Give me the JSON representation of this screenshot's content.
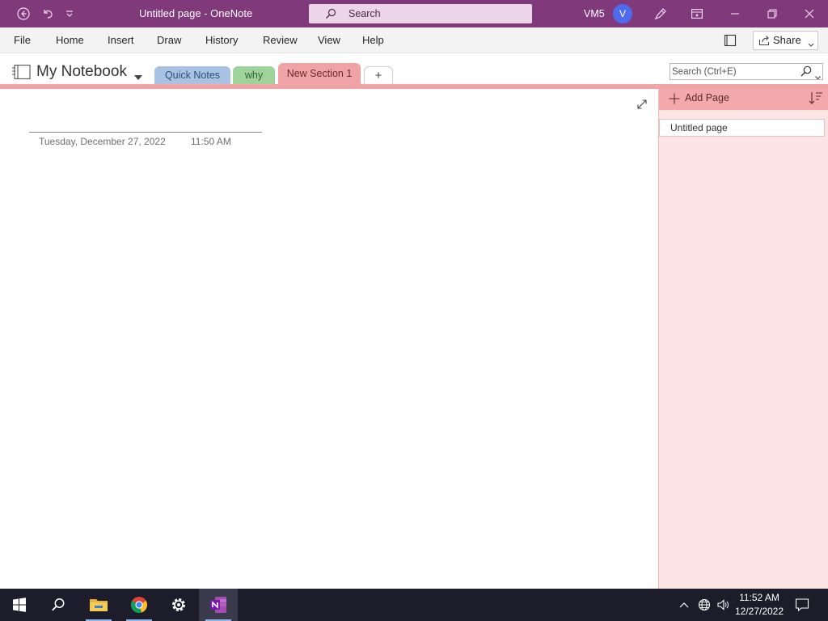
{
  "titlebar": {
    "doc_title": "Untitled page  -  OneNote",
    "search_label": "Search",
    "user_name": "VM5",
    "avatar_initial": "V",
    "color": "#80397b"
  },
  "menu": {
    "items": [
      "File",
      "Home",
      "Insert",
      "Draw",
      "History",
      "Review",
      "View",
      "Help"
    ],
    "share_label": "Share"
  },
  "notebook": {
    "name": "My Notebook",
    "sections": [
      {
        "label": "Quick Notes",
        "color": "#a7c2e3"
      },
      {
        "label": "why",
        "color": "#9ed49a"
      },
      {
        "label": "New Section 1",
        "color": "#f0a3a5",
        "active": true
      }
    ],
    "add_section_label": "+",
    "search_placeholder": "Search (Ctrl+E)"
  },
  "page": {
    "date": "Tuesday, December 27, 2022",
    "time": "11:50 AM"
  },
  "pages_pane": {
    "add_page_label": "Add Page",
    "pages": [
      "Untitled page"
    ]
  },
  "taskbar": {
    "apps": [
      "start-icon",
      "search-icon",
      "file-explorer-icon",
      "chrome-icon",
      "settings-icon",
      "onenote-icon"
    ],
    "clock_time": "11:52 AM",
    "clock_date": "12/27/2022"
  }
}
